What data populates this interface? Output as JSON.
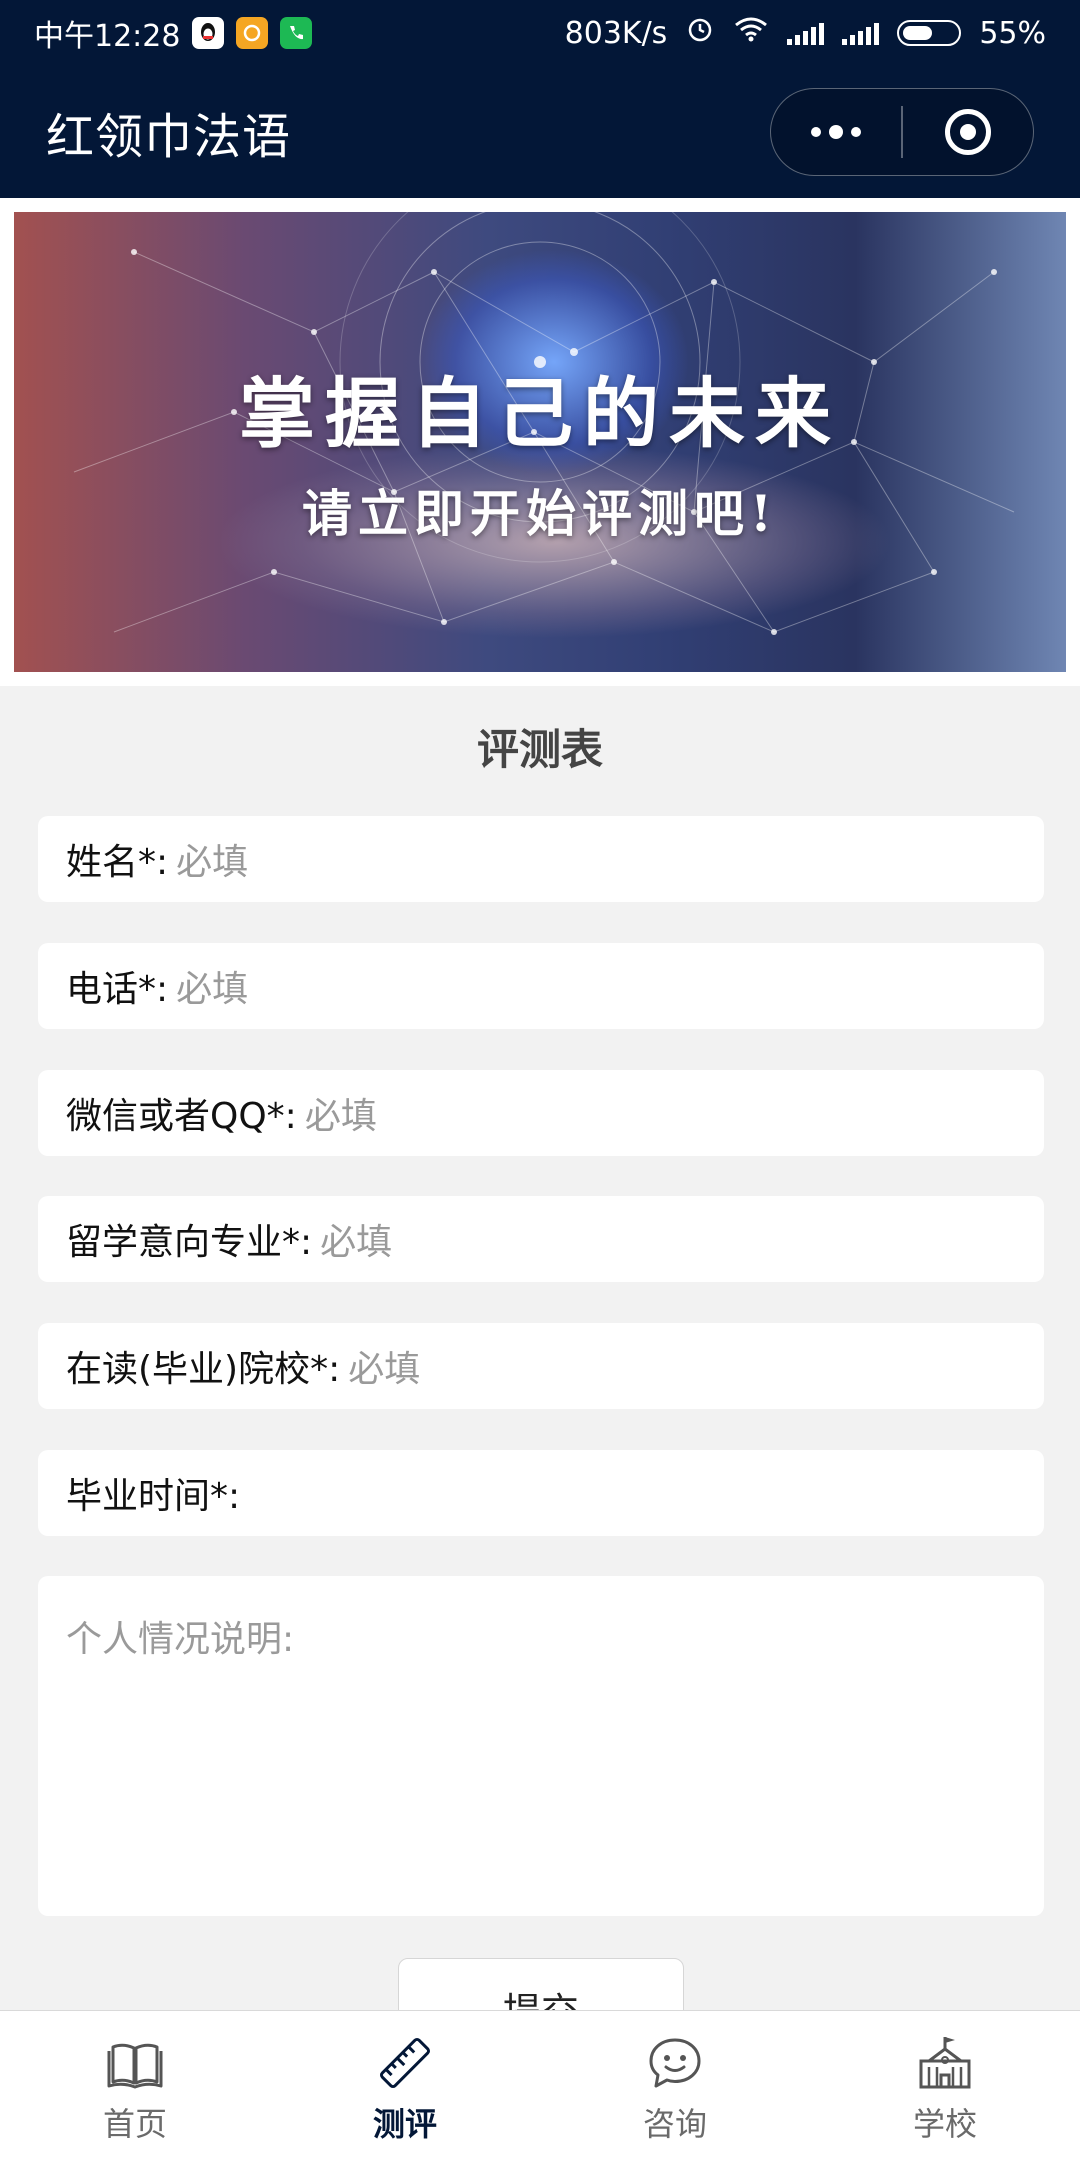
{
  "status_bar": {
    "time": "中午12:28",
    "network_speed": "803K/s",
    "battery": "55%",
    "battery_level": 0.55,
    "app_icons": [
      "qq-icon",
      "message-icon",
      "phone-icon"
    ]
  },
  "nav": {
    "title": "红领巾法语",
    "more_icon": "more-dots-icon",
    "close_icon": "target-circle-icon"
  },
  "banner": {
    "title": "掌握自己的未来",
    "subtitle": "请立即开始评测吧!"
  },
  "form": {
    "title": "评测表",
    "fields": [
      {
        "label": "姓名*:",
        "placeholder": "必填"
      },
      {
        "label": "电话*:",
        "placeholder": "必填"
      },
      {
        "label": "微信或者QQ*:",
        "placeholder": "必填"
      },
      {
        "label": "留学意向专业*:",
        "placeholder": "必填"
      },
      {
        "label": "在读(毕业)院校*:",
        "placeholder": "必填"
      },
      {
        "label": "毕业时间*:",
        "placeholder": ""
      }
    ],
    "remarks_placeholder": "个人情况说明:",
    "submit_label": "提交"
  },
  "tabbar": {
    "tabs": [
      {
        "label": "首页",
        "icon": "book-icon",
        "active": false
      },
      {
        "label": "测评",
        "icon": "ruler-icon",
        "active": true
      },
      {
        "label": "咨询",
        "icon": "chat-icon",
        "active": false
      },
      {
        "label": "学校",
        "icon": "school-icon",
        "active": false
      }
    ]
  },
  "colors": {
    "header_bg": "#031737",
    "page_bg": "#f2f2f2",
    "active_tab": "#031737"
  }
}
